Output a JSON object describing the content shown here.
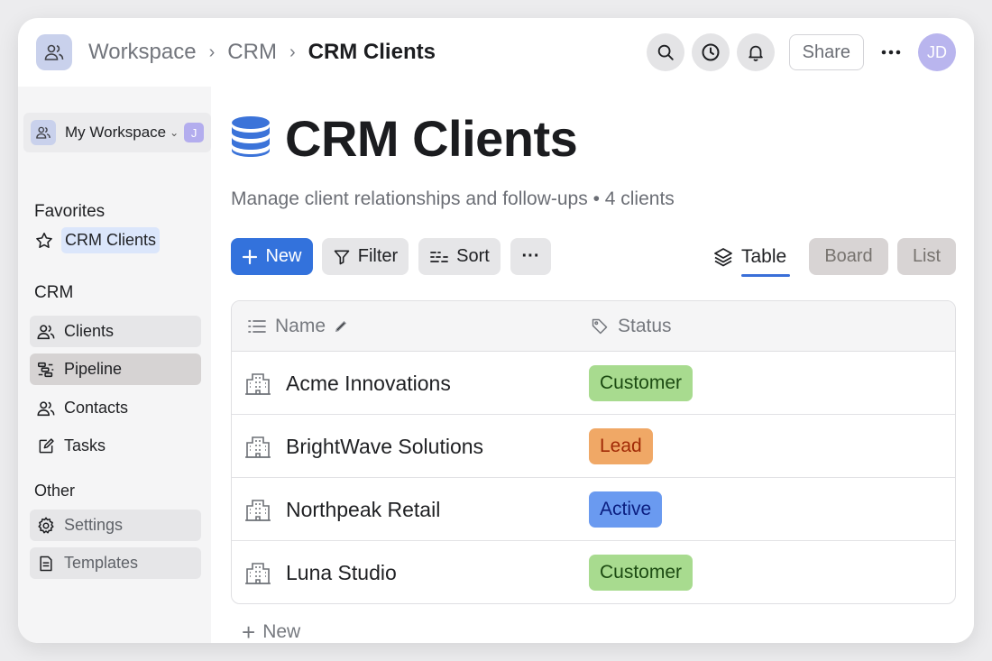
{
  "breadcrumbs": [
    "Workspace",
    "CRM",
    "CRM Clients"
  ],
  "topbar": {
    "share_label": "Share",
    "avatar_initials": "JD",
    "icons": [
      "search-icon",
      "clock-icon",
      "bell-icon",
      "more-icon"
    ]
  },
  "sidebar": {
    "workspace_name": "My Workspace",
    "workspace_badge": "J",
    "favorites_heading": "Favorites",
    "favorites": [
      {
        "label": "CRM Clients",
        "icon": "star-icon"
      }
    ],
    "crm_heading": "CRM",
    "crm_items": [
      {
        "label": "Clients",
        "icon": "users-icon"
      },
      {
        "label": "Pipeline",
        "icon": "pipeline-icon"
      },
      {
        "label": "Contacts",
        "icon": "users-icon"
      },
      {
        "label": "Tasks",
        "icon": "edit-icon"
      }
    ],
    "other_heading": "Other",
    "other_items": [
      {
        "label": "Settings",
        "icon": "gear-icon"
      },
      {
        "label": "Templates",
        "icon": "document-icon"
      }
    ]
  },
  "main": {
    "title": "CRM Clients",
    "subtitle": "Manage client relationships and follow-ups • 4 clients",
    "toolbar": {
      "new_label": "New",
      "filter_label": "Filter",
      "sort_label": "Sort",
      "more_label": "···"
    },
    "views": {
      "active": "Table",
      "others": [
        "Board",
        "List"
      ]
    },
    "table": {
      "columns": [
        "Name",
        "Status"
      ],
      "rows": [
        {
          "name": "Acme Innovations",
          "status": "Customer"
        },
        {
          "name": "BrightWave Solutions",
          "status": "Lead"
        },
        {
          "name": "Northpeak Retail",
          "status": "Active"
        },
        {
          "name": "Luna Studio",
          "status": "Customer"
        }
      ]
    },
    "add_new_label": "New"
  },
  "colors": {
    "primary": "#3372dc",
    "customer_bg": "#a8db8f",
    "customer_fg": "#1c4a12",
    "lead_bg": "#f0a866",
    "lead_fg": "#a12a06",
    "active_bg": "#6a9af0",
    "active_fg": "#0b1e80"
  }
}
